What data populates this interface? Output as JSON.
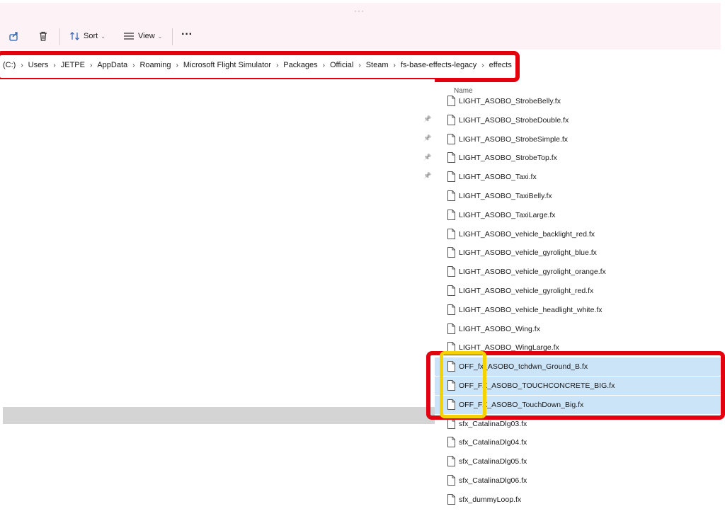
{
  "toolbar": {
    "sort_label": "Sort",
    "view_label": "View",
    "more_label": "···",
    "grip": "···"
  },
  "breadcrumb": [
    "(C:)",
    "Users",
    "JETPE",
    "AppData",
    "Roaming",
    "Microsoft Flight Simulator",
    "Packages",
    "Official",
    "Steam",
    "fs-base-effects-legacy",
    "effects"
  ],
  "columns": {
    "name": "Name"
  },
  "files": [
    {
      "name": "LIGHT_ASOBO_StrobeBelly.fx",
      "selected": false
    },
    {
      "name": "LIGHT_ASOBO_StrobeDouble.fx",
      "selected": false
    },
    {
      "name": "LIGHT_ASOBO_StrobeSimple.fx",
      "selected": false
    },
    {
      "name": "LIGHT_ASOBO_StrobeTop.fx",
      "selected": false
    },
    {
      "name": "LIGHT_ASOBO_Taxi.fx",
      "selected": false
    },
    {
      "name": "LIGHT_ASOBO_TaxiBelly.fx",
      "selected": false
    },
    {
      "name": "LIGHT_ASOBO_TaxiLarge.fx",
      "selected": false
    },
    {
      "name": "LIGHT_ASOBO_vehicle_backlight_red.fx",
      "selected": false
    },
    {
      "name": "LIGHT_ASOBO_vehicle_gyrolight_blue.fx",
      "selected": false
    },
    {
      "name": "LIGHT_ASOBO_vehicle_gyrolight_orange.fx",
      "selected": false
    },
    {
      "name": "LIGHT_ASOBO_vehicle_gyrolight_red.fx",
      "selected": false
    },
    {
      "name": "LIGHT_ASOBO_vehicle_headlight_white.fx",
      "selected": false
    },
    {
      "name": "LIGHT_ASOBO_Wing.fx",
      "selected": false
    },
    {
      "name": "LIGHT_ASOBO_WingLarge.fx",
      "selected": false
    },
    {
      "name": "OFF_fx_ASOBO_tchdwn_Ground_B.fx",
      "selected": true
    },
    {
      "name": "OFF_FX_ASOBO_TOUCHCONCRETE_BIG.fx",
      "selected": true
    },
    {
      "name": "OFF_FX_ASOBO_TouchDown_Big.fx",
      "selected": true
    },
    {
      "name": "sfx_CatalinaDlg03.fx",
      "selected": false
    },
    {
      "name": "sfx_CatalinaDlg04.fx",
      "selected": false
    },
    {
      "name": "sfx_CatalinaDlg05.fx",
      "selected": false
    },
    {
      "name": "sfx_CatalinaDlg06.fx",
      "selected": false
    },
    {
      "name": "sfx_dummyLoop.fx",
      "selected": false
    }
  ],
  "quick_access_pins": 4,
  "colors": {
    "annotation_red": "#e3000f",
    "annotation_yellow": "#f5d300",
    "selection": "#cce4f7",
    "toolbar_bg": "#fdf2f6"
  }
}
